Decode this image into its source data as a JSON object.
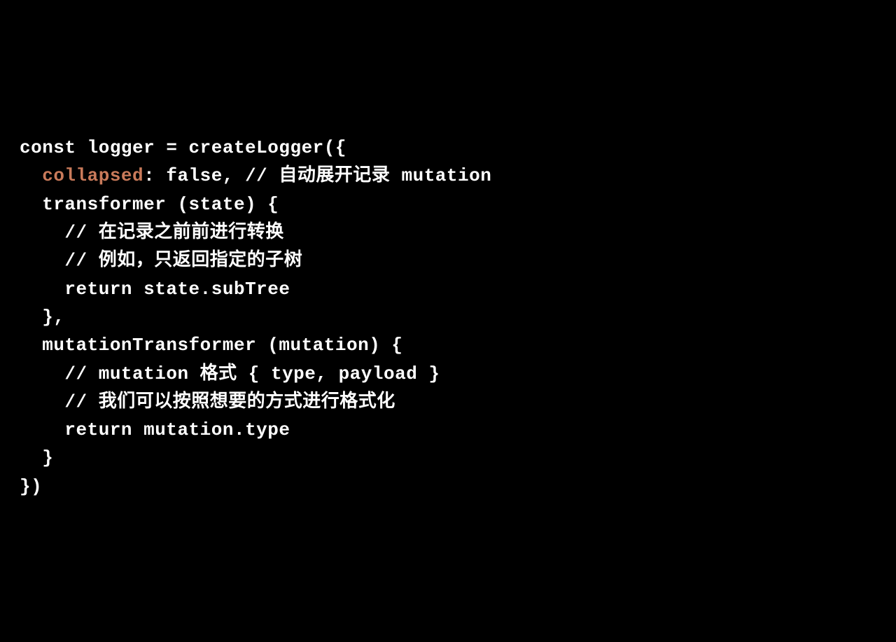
{
  "code": {
    "lines": [
      {
        "indent": 0,
        "segments": [
          {
            "t": "const logger = createLogger({",
            "c": "plain"
          }
        ]
      },
      {
        "indent": 1,
        "segments": [
          {
            "t": "collapsed",
            "c": "hl"
          },
          {
            "t": ": false, // 自动展开记录 mutation",
            "c": "plain"
          }
        ]
      },
      {
        "indent": 1,
        "segments": [
          {
            "t": "transformer (state) {",
            "c": "plain"
          }
        ]
      },
      {
        "indent": 2,
        "segments": [
          {
            "t": "// 在记录之前前进行转换",
            "c": "plain"
          }
        ]
      },
      {
        "indent": 2,
        "segments": [
          {
            "t": "// 例如，只返回指定的子树",
            "c": "plain"
          }
        ]
      },
      {
        "indent": 2,
        "segments": [
          {
            "t": "return state.subTree",
            "c": "plain"
          }
        ]
      },
      {
        "indent": 1,
        "segments": [
          {
            "t": "},",
            "c": "plain"
          }
        ]
      },
      {
        "indent": 1,
        "segments": [
          {
            "t": "mutationTransformer (mutation) {",
            "c": "plain"
          }
        ]
      },
      {
        "indent": 2,
        "segments": [
          {
            "t": "// mutation 格式 { type, payload }",
            "c": "plain"
          }
        ]
      },
      {
        "indent": 2,
        "segments": [
          {
            "t": "// 我们可以按照想要的方式进行格式化",
            "c": "plain"
          }
        ]
      },
      {
        "indent": 2,
        "segments": [
          {
            "t": "return mutation.type",
            "c": "plain"
          }
        ]
      },
      {
        "indent": 1,
        "segments": [
          {
            "t": "}",
            "c": "plain"
          }
        ]
      },
      {
        "indent": 0,
        "segments": [
          {
            "t": "})",
            "c": "plain"
          }
        ]
      }
    ]
  }
}
